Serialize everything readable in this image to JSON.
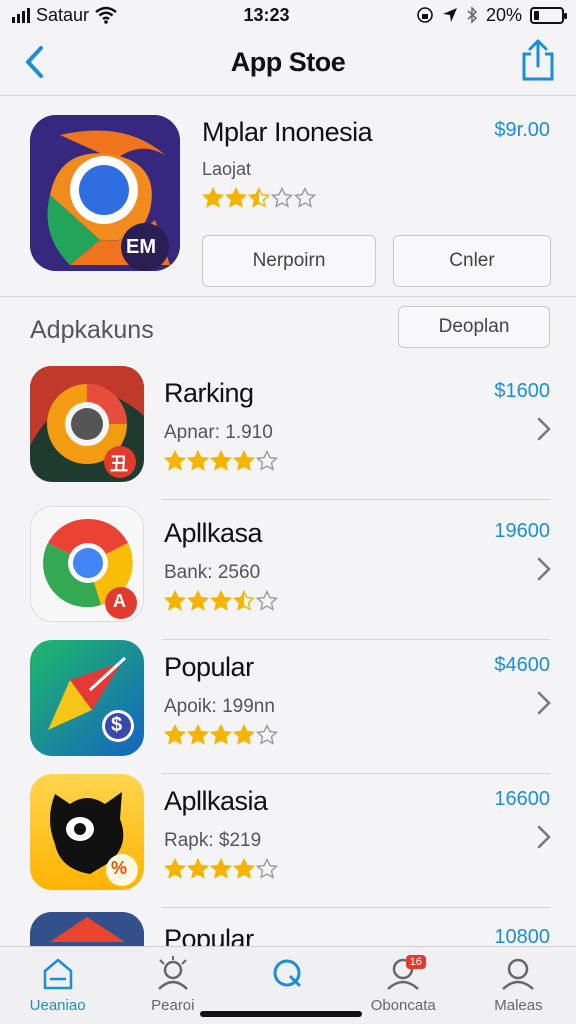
{
  "status": {
    "carrier": "Sataur",
    "time": "13:23",
    "battery_text": "20%",
    "battery_level": 0.2
  },
  "nav": {
    "title": "App Stoe"
  },
  "featured": {
    "name": "Mplar Inonesia",
    "subtitle": "Laojat",
    "price": "$9r.00",
    "rating": 2.5,
    "badge": "EM",
    "button_left": "Nerpoirn",
    "button_right": "Cnler"
  },
  "section": {
    "title": "Adpkakuns",
    "button": "Deoplan"
  },
  "apps": [
    {
      "name": "Rarking",
      "sub": "Apnar:  1.910",
      "price": "$1600",
      "rating": 4,
      "badge": "丑"
    },
    {
      "name": "Apllkasa",
      "sub": "Bank: 2560",
      "price": "19600",
      "rating": 3.5,
      "badge": "A"
    },
    {
      "name": "Popular",
      "sub": "Apoik:  199nn",
      "price": "$4600",
      "rating": 4,
      "badge": "$"
    },
    {
      "name": "Apllkasia",
      "sub": "Rapk: $219",
      "price": "16600",
      "rating": 4,
      "badge": "%"
    },
    {
      "name": "Popular",
      "price": "10800"
    }
  ],
  "tabs": [
    {
      "label": "Ueaniao",
      "icon": "home-icon"
    },
    {
      "label": "Pearoi",
      "icon": "profile-icon"
    },
    {
      "label": "",
      "icon": "search-icon"
    },
    {
      "label": "Oboncata",
      "icon": "user-icon",
      "badge": "16"
    },
    {
      "label": "Maleas",
      "icon": "account-icon"
    }
  ],
  "colors": {
    "accent": "#1a8fd6",
    "star": "#f5b400",
    "badge_red": "#e23a2c"
  }
}
